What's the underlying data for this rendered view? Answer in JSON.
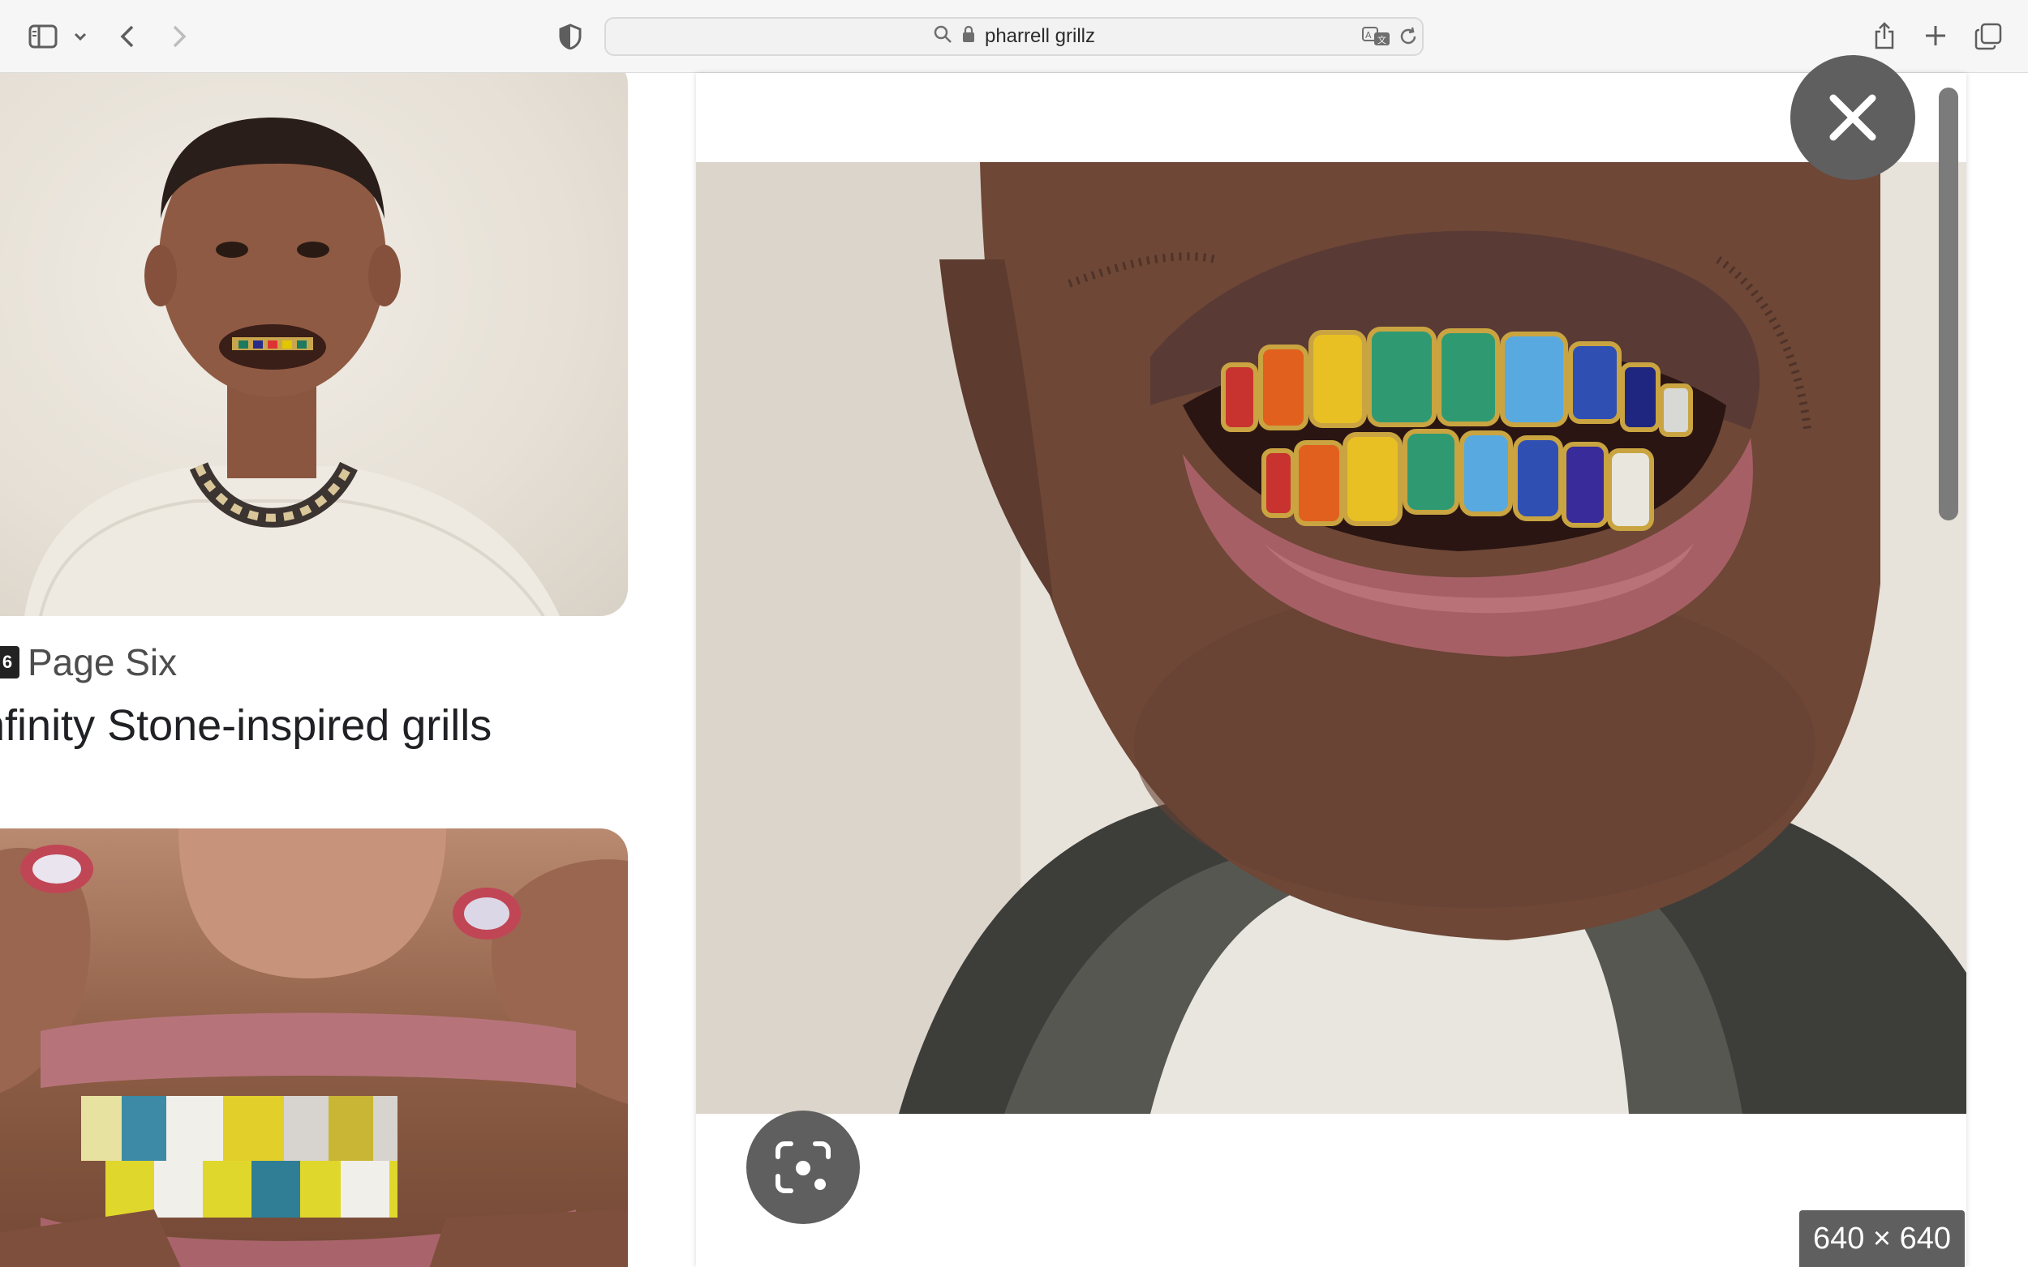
{
  "browser": {
    "address_text": "pharrell grillz",
    "icons": {
      "sidebar": "sidebar-icon",
      "back": "chevron-left-icon",
      "forward": "chevron-right-icon",
      "privacy": "shield-icon",
      "search": "search-icon",
      "lock": "lock-icon",
      "translate": "translate-icon",
      "reload": "reload-icon",
      "share": "share-icon",
      "new_tab": "plus-icon",
      "tabs": "tab-overview-icon"
    }
  },
  "results": {
    "source_name": "Page Six",
    "result_title": "nfinity Stone-inspired grills"
  },
  "preview": {
    "dimensions": "640 × 640",
    "close_icon": "close-icon",
    "lens_icon": "visual-search-icon"
  }
}
